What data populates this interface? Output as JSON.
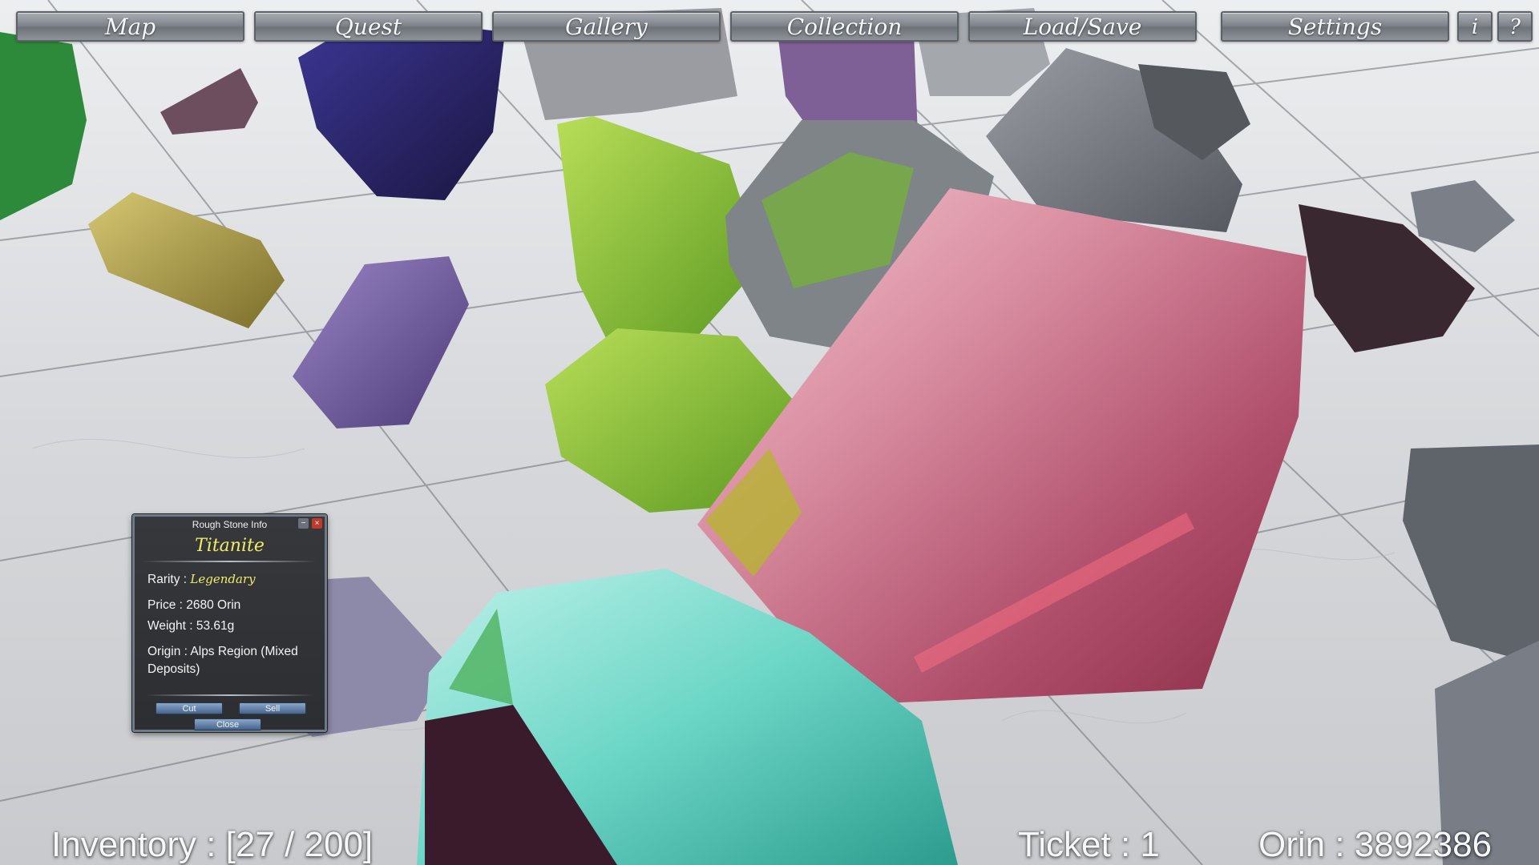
{
  "menu": {
    "items": [
      {
        "label": "Map"
      },
      {
        "label": "Quest"
      },
      {
        "label": "Gallery"
      },
      {
        "label": "Collection"
      },
      {
        "label": "Load/Save"
      },
      {
        "label": "Settings"
      }
    ],
    "info_label": "i",
    "help_label": "?"
  },
  "info_panel": {
    "title": "Rough Stone Info",
    "minimize_glyph": "−",
    "close_glyph": "×",
    "stone_name": "Titanite",
    "rarity_label": "Rarity : ",
    "rarity_value": "Legendary",
    "price": "Price : 2680 Orin",
    "weight": "Weight : 53.61g",
    "origin": "Origin : Alps Region (Mixed Deposits)",
    "buttons": {
      "cut": "Cut",
      "sell": "Sell",
      "close": "Close"
    }
  },
  "hud": {
    "inventory": "Inventory : [27 / 200]",
    "ticket": "Ticket : 1",
    "orin": "Orin : 3892386"
  },
  "colors": {
    "highlight_yellow": "#f1ec66",
    "menu_button": "#8d9398",
    "panel_bg": "#2f3135"
  }
}
